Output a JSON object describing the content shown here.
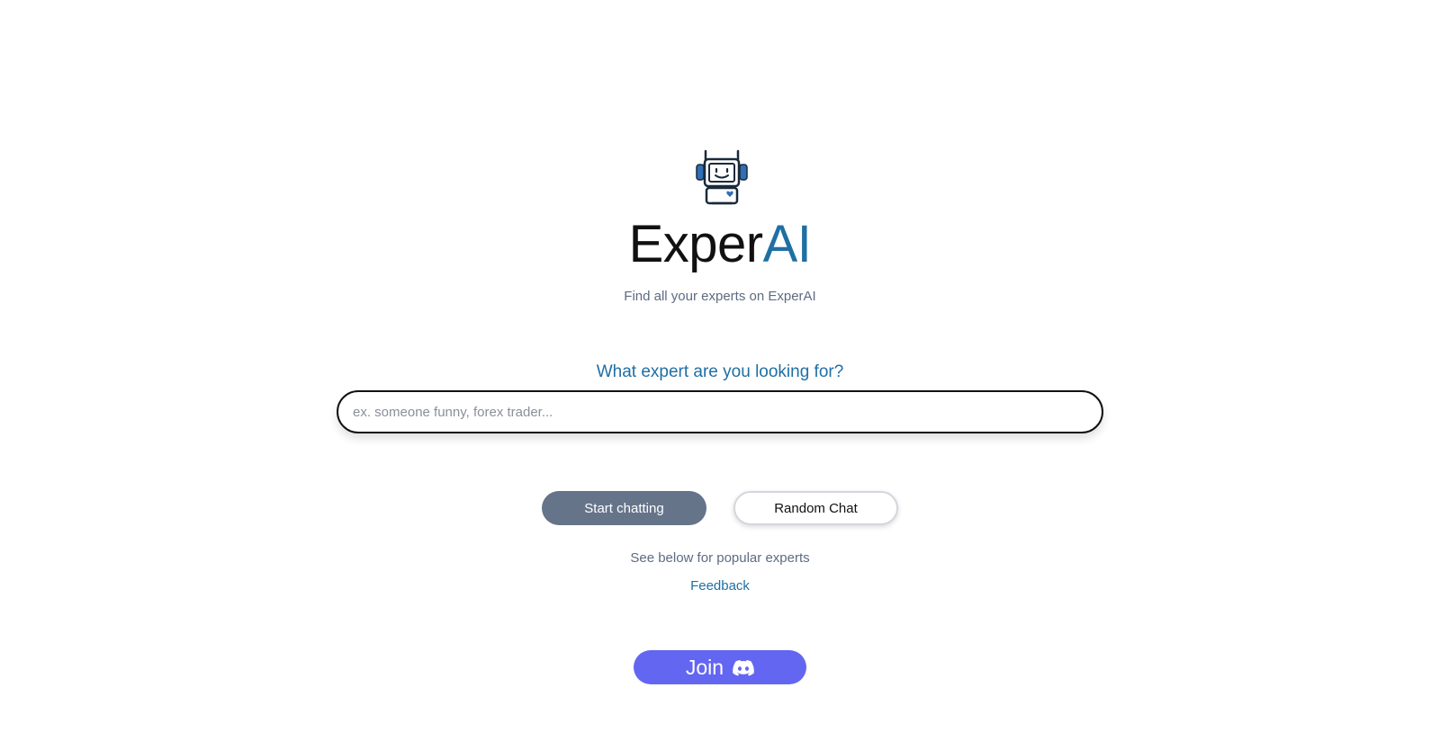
{
  "brand": {
    "name_main": "Exper",
    "name_accent": "AI",
    "tagline": "Find all your experts on ExperAI",
    "logo_icon": "robot-headset-icon"
  },
  "search": {
    "question": "What expert are you looking for?",
    "placeholder": "ex. someone funny, forex trader...",
    "value": ""
  },
  "actions": {
    "start_label": "Start chatting",
    "random_label": "Random Chat"
  },
  "links": {
    "popular_text": "See below for popular experts",
    "feedback_label": "Feedback"
  },
  "join": {
    "label": "Join",
    "icon": "discord-icon"
  },
  "colors": {
    "accent": "#1f6fa3",
    "start_button": "#66748a",
    "join_button": "#6366f1",
    "muted_text": "#5d6b82"
  }
}
